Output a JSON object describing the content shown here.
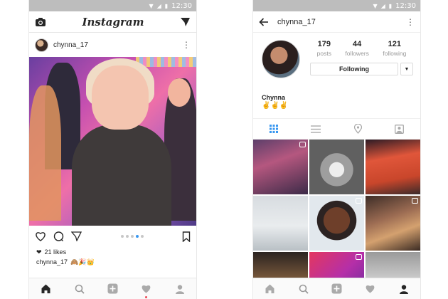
{
  "status_bar": {
    "time": "12:30"
  },
  "feed": {
    "app_title": "Instagram",
    "post": {
      "username": "chynna_17",
      "likes": "21 likes",
      "caption_user": "chynna_17",
      "caption_text": "🙈🎉👑",
      "carousel": {
        "count": 5,
        "active_index": 3
      }
    }
  },
  "profile": {
    "username": "chynna_17",
    "stats": [
      {
        "value": "179",
        "label": "posts"
      },
      {
        "value": "44",
        "label": "followers"
      },
      {
        "value": "121",
        "label": "following"
      }
    ],
    "follow_button": "Following",
    "bio_name": "Chynna",
    "bio_text": "✌✌✌",
    "grid_count": 9
  },
  "colors": {
    "accent": "#3897f0",
    "notification": "#ed4956",
    "status_bar": "#bdbdbd"
  },
  "icons": [
    "camera-icon",
    "direct-send-icon",
    "more-icon",
    "heart-icon",
    "comment-icon",
    "share-icon",
    "bookmark-icon",
    "home-icon",
    "search-icon",
    "add-icon",
    "activity-icon",
    "profile-icon",
    "back-arrow-icon",
    "grid-icon",
    "list-icon",
    "location-icon",
    "tagged-icon"
  ]
}
